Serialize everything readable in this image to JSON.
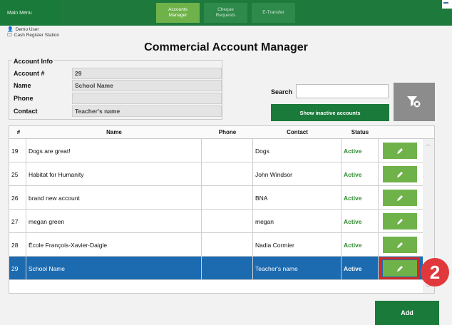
{
  "topbar": {
    "main_menu": "Main Menu",
    "tabs": [
      {
        "label": "Accounts\nManager",
        "active": true
      },
      {
        "label": "Cheque\nRequests",
        "active": false
      },
      {
        "label": "E-Transfer",
        "active": false
      }
    ],
    "accent": "#1e7a3c"
  },
  "user": {
    "name": "Demo User",
    "station": "Cash Register Station"
  },
  "page_title": "Commercial Account Manager",
  "account_info": {
    "title": "Account Info",
    "fields": [
      {
        "label": "Account #",
        "value": "29"
      },
      {
        "label": "Name",
        "value": "School Name"
      },
      {
        "label": "Phone",
        "value": ""
      },
      {
        "label": "Contact",
        "value": "Teacher's name"
      }
    ]
  },
  "search": {
    "label": "Search",
    "value": "",
    "inactive_button": "Show inactive accounts",
    "filter_icon": "filter-clear-icon"
  },
  "table": {
    "columns": [
      "#",
      "Name",
      "Phone",
      "Contact",
      "Status"
    ],
    "rows": [
      {
        "id": "19",
        "name": "Dogs are great!",
        "phone": "",
        "contact": "Dogs",
        "status": "Active"
      },
      {
        "id": "25",
        "name": "Habitat for Humanity",
        "phone": "",
        "contact": "John Windsor",
        "status": "Active"
      },
      {
        "id": "26",
        "name": "brand new account",
        "phone": "",
        "contact": "BNA",
        "status": "Active"
      },
      {
        "id": "27",
        "name": "megan green",
        "phone": "",
        "contact": "megan",
        "status": "Active"
      },
      {
        "id": "28",
        "name": "École François-Xavier-Daigle",
        "phone": "",
        "contact": "Nadia Cormier",
        "status": "Active"
      },
      {
        "id": "29",
        "name": "School Name",
        "phone": "",
        "contact": "Teacher's name",
        "status": "Active",
        "selected": true
      }
    ],
    "edit_icon": "pencil-icon",
    "status_color": "#2e8b2e",
    "selected_color": "#1c6ab0"
  },
  "annotation_badge": "2",
  "add_button": "Add"
}
